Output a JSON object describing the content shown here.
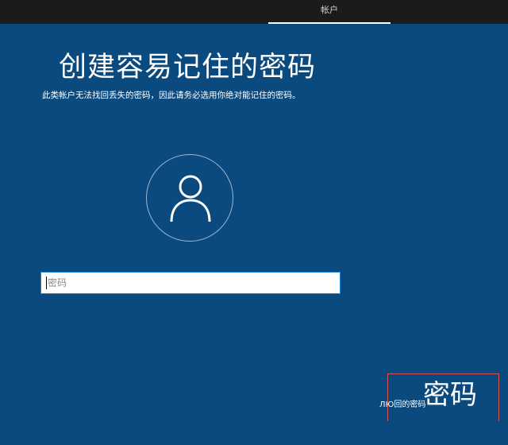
{
  "header": {
    "tab_label": "帐户"
  },
  "main": {
    "title": "创建容易记住的密码",
    "subtitle": "此类帐户无法找回丢失的密码，因此请务必选用你绝对能记住的密码。"
  },
  "password": {
    "placeholder": "密码"
  },
  "watermark": {
    "large_text": "密码",
    "small_text": "ЛЮ回的密码"
  },
  "colors": {
    "background": "#0b4a7e",
    "topbar": "#1b1b1b",
    "input_border": "#1e86d4",
    "highlight_border": "#d9534f"
  },
  "icons": {
    "avatar": "user-icon"
  }
}
